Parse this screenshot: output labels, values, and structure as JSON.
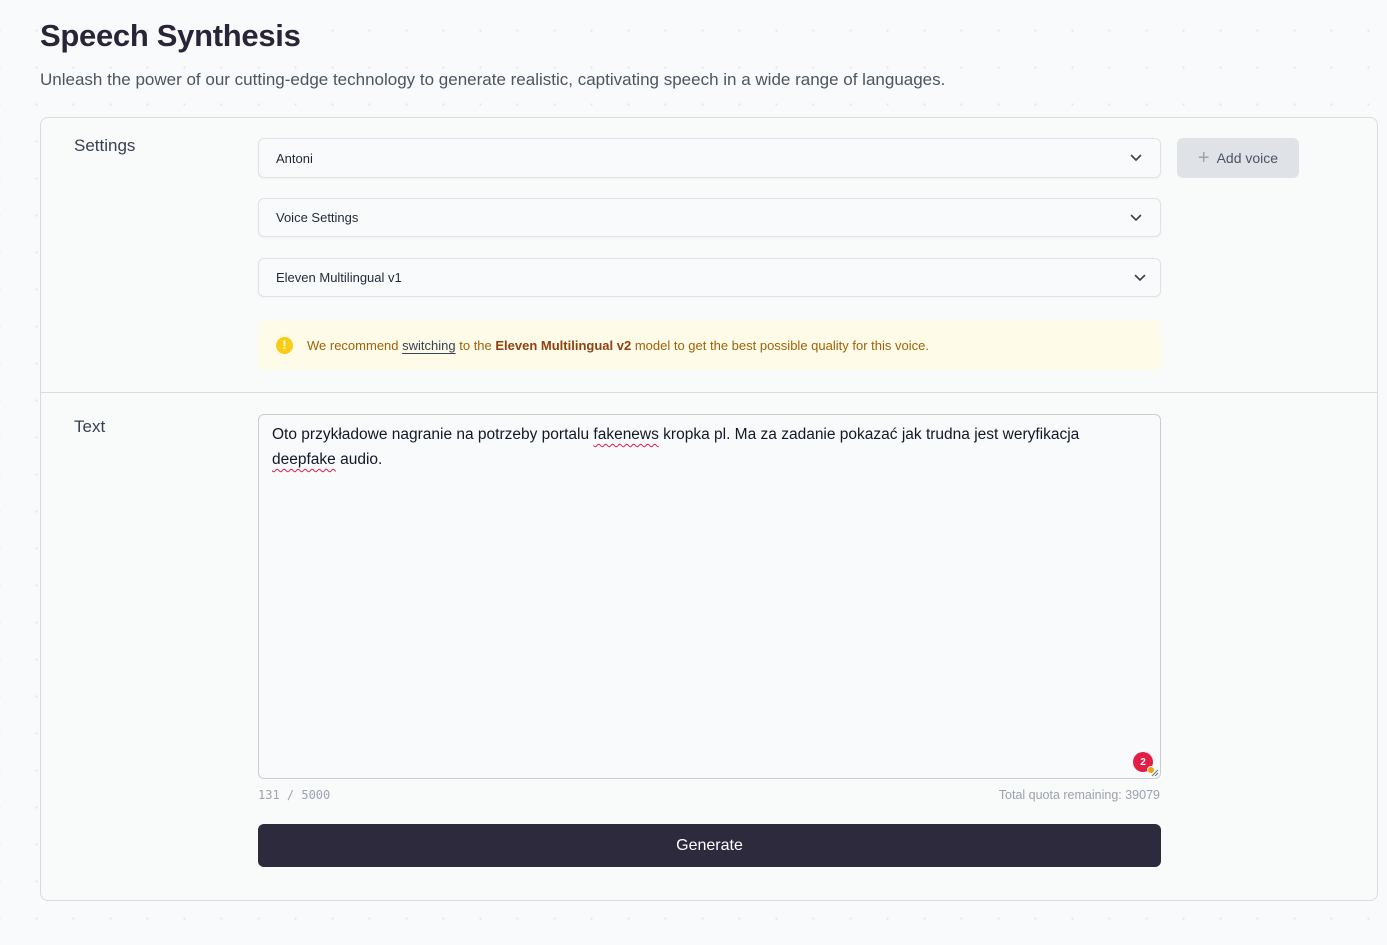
{
  "header": {
    "title": "Speech Synthesis",
    "subtitle": "Unleash the power of our cutting-edge technology to generate realistic, captivating speech in a wide range of languages."
  },
  "settings": {
    "label": "Settings",
    "voice_select": {
      "value": "Antoni",
      "icon": "chevron-down-icon"
    },
    "voice_settings_select": {
      "value": "Voice Settings",
      "icon": "chevron-down-icon"
    },
    "model_select": {
      "value": "Eleven Multilingual v1",
      "icon": "chevron-down-icon"
    },
    "add_voice": {
      "label": "Add voice",
      "icon": "plus-icon"
    },
    "notice": {
      "icon": "warning-icon",
      "prefix": "We recommend",
      "link": "switching",
      "middle": "to the",
      "model": "Eleven Multilingual v2",
      "suffix": "model to get the best possible quality for this voice."
    }
  },
  "text_section": {
    "label": "Text",
    "content": {
      "part1": "Oto przykładowe nagranie na potrzeby portalu ",
      "misspelled1": "fakenews",
      "part2": " kropka pl. Ma za zadanie pokazać jak trudna jest weryfikacja ",
      "misspelled2": "deepfake",
      "part3": " audio."
    },
    "extension_badge_count": "2",
    "char_count": "131 / 5000",
    "quota": "Total quota remaining: 39079"
  },
  "actions": {
    "generate_label": "Generate"
  },
  "colors": {
    "primary_button": "#2d2a3e",
    "notice_background": "#fefbe8",
    "notice_text": "#a16207",
    "warning_icon": "#facc15",
    "spellcheck": "#e11d48"
  }
}
